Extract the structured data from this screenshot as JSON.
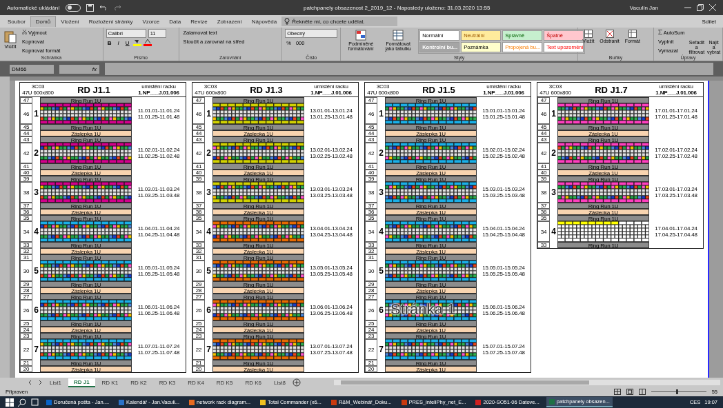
{
  "window": {
    "autosave_label": "Automatické ukládání",
    "autosave_on": false,
    "title": "patchpanely obsazenost 2_2019_12  -  Naposledy uloženo: 31.03.2020 13:55",
    "user": "Vaculín Jan"
  },
  "menu_tabs": [
    {
      "label": "Soubor",
      "selected": false
    },
    {
      "label": "Domů",
      "selected": true
    },
    {
      "label": "Vložení",
      "selected": false
    },
    {
      "label": "Rozložení stránky",
      "selected": false
    },
    {
      "label": "Vzorce",
      "selected": false
    },
    {
      "label": "Data",
      "selected": false
    },
    {
      "label": "Revize",
      "selected": false
    },
    {
      "label": "Zobrazení",
      "selected": false
    },
    {
      "label": "Nápověda",
      "selected": false
    }
  ],
  "tell_me": {
    "placeholder": "Řekněte mi, co chcete udělat."
  },
  "share_label": "Sdílet",
  "ribbon": {
    "clipboard": {
      "paste": "Vložit",
      "cut": "Vyjmout",
      "copy": "Kopírovat",
      "format_painter": "Kopírovat formát",
      "group": "Schránka"
    },
    "font": {
      "name": "Calibri",
      "size": "11",
      "buttons": [
        "B",
        "I",
        "U"
      ],
      "group": "Písmo"
    },
    "alignment": {
      "wrap": "Zalamovat text",
      "merge": "Sloučit a zarovnat na střed",
      "group": "Zarovnání"
    },
    "number": {
      "format": "Obecný",
      "percent": "%",
      "thousands": "000",
      "group": "Číslo"
    },
    "styles": {
      "conditional": "Podmíněné formátování",
      "as_table": "Formátovat jako tabulku",
      "group": "Styly",
      "cells": [
        {
          "label": "Normální",
          "color": "#ffffff"
        },
        {
          "label": "Neutrální",
          "color": "#ffeb9c"
        },
        {
          "label": "Správně",
          "color": "#c6efce"
        },
        {
          "label": "Špatně",
          "color": "#ffc7ce"
        },
        {
          "label": "Kontrolní bu...",
          "color": "#a5a5a5"
        },
        {
          "label": "Poznámka",
          "color": "#ffffcc"
        },
        {
          "label": "Propojená bu...",
          "color": "#ffffff"
        },
        {
          "label": "Text upozornění",
          "color": "#ffffff"
        }
      ]
    },
    "cells": {
      "insert": "Vložit",
      "delete": "Odstranit",
      "format": "Formát",
      "group": "Buňky"
    },
    "editing": {
      "autosum": "AutoSum",
      "fill": "Vyplnit",
      "clear": "Vymazat",
      "sort": "Seřadit a filtrovat",
      "find": "Najít a vybrat",
      "group": "Úpravy"
    }
  },
  "formula_bar": {
    "name_box": "DM66",
    "fx": "fx"
  },
  "page_label": "Stránka 1",
  "racks": [
    {
      "title": "RD J1.1",
      "code": "3C03",
      "size": "47U  600x800",
      "location_label": "umístění racku",
      "location": "1.NP___J.01.006",
      "units": [
        {
          "kind": "ringrun",
          "u": "47",
          "label": "Ring Run 1U"
        },
        {
          "kind": "panel",
          "u": "46",
          "number": "1",
          "color": "#d4008c",
          "filled": true,
          "ranges": [
            "11.01.01-11.01.24",
            "11.01.25-11.01.48"
          ]
        },
        {
          "kind": "ringrun",
          "u": "45",
          "label": "Ring Run 1U"
        },
        {
          "kind": "blank",
          "u": "44",
          "label": "Záslepka 1U"
        },
        {
          "kind": "ringrun",
          "u": "43",
          "label": "Ring Run 1U"
        },
        {
          "kind": "panel",
          "u": "42",
          "number": "2",
          "color": "#d4008c",
          "filled": true,
          "ranges": [
            "11.02.01-11.02.24",
            "11.02.25-11.02.48"
          ]
        },
        {
          "kind": "ringrun",
          "u": "41",
          "label": "Ring Run 1U"
        },
        {
          "kind": "blank",
          "u": "40",
          "label": "Záslepka 1U"
        },
        {
          "kind": "ringrun",
          "u": "39",
          "label": "Ring Run 1U"
        },
        {
          "kind": "panel",
          "u": "38",
          "number": "3",
          "color": "#d4008c",
          "filled": true,
          "ranges": [
            "11.03.01-11.03.24",
            "11.03.25-11.03.48"
          ]
        },
        {
          "kind": "ringrun",
          "u": "37",
          "label": "Ring Run 1U"
        },
        {
          "kind": "blank",
          "u": "36",
          "label": "Záslepka 1U"
        },
        {
          "kind": "ringrun",
          "u": "35",
          "label": "Ring Run 1U"
        },
        {
          "kind": "panel",
          "u": "34",
          "number": "4",
          "color": "#1ab0e8",
          "filled": true,
          "ranges": [
            "11.04.01-11.04.24",
            "11.04.25-11.04.48"
          ]
        },
        {
          "kind": "ringrun",
          "u": "33",
          "label": "Ring Run 1U"
        },
        {
          "kind": "blank",
          "u": "32",
          "label": "Záslepka 1U"
        },
        {
          "kind": "ringrun",
          "u": "31",
          "label": "Ring Run 1U"
        },
        {
          "kind": "panel",
          "u": "30",
          "number": "5",
          "color": "#1ab0e8",
          "filled": true,
          "ranges": [
            "11.05.01-11.05.24",
            "11.05.25-11.05.48"
          ]
        },
        {
          "kind": "ringrun",
          "u": "29",
          "label": "Ring Run 1U"
        },
        {
          "kind": "blank",
          "u": "28",
          "label": "Záslepka 1U"
        },
        {
          "kind": "ringrun",
          "u": "27",
          "label": "Ring Run 1U"
        },
        {
          "kind": "panel",
          "u": "26",
          "number": "6",
          "color": "#1ab0e8",
          "filled": true,
          "ranges": [
            "11.06.01-11.06.24",
            "11.06.25-11.06.48"
          ]
        },
        {
          "kind": "ringrun",
          "u": "25",
          "label": "Ring Run 1U"
        },
        {
          "kind": "blank",
          "u": "24",
          "label": "Záslepka 1U"
        },
        {
          "kind": "ringrun",
          "u": "23",
          "label": "Ring Run 1U"
        },
        {
          "kind": "panel",
          "u": "22",
          "number": "7",
          "color": "#1ab0e8",
          "filled": true,
          "ranges": [
            "11.07.01-11.07.24",
            "11.07.25-11.07.48"
          ]
        },
        {
          "kind": "ringrun",
          "u": "21",
          "label": "Ring Run 1U"
        },
        {
          "kind": "blank",
          "u": "20",
          "label": "Záslepka 1U"
        }
      ]
    },
    {
      "title": "RD J1.3",
      "code": "3C03",
      "size": "47U  600x800",
      "location_label": "umístění racku",
      "location": "1.NP___J.01.006",
      "units": [
        {
          "kind": "ringrun",
          "u": "47",
          "label": "Ring Run 1U"
        },
        {
          "kind": "panel",
          "u": "46",
          "number": "1",
          "color": "#d2d200",
          "filled": true,
          "ranges": [
            "13.01.01-13.01.24",
            "13.01.25-13.01.48"
          ]
        },
        {
          "kind": "ringrun",
          "u": "45",
          "label": "Ring Run 1U"
        },
        {
          "kind": "blank",
          "u": "44",
          "label": "Záslepka 1U"
        },
        {
          "kind": "ringrun",
          "u": "43",
          "label": "Ring Run 1U"
        },
        {
          "kind": "panel",
          "u": "42",
          "number": "2",
          "color": "#d2d200",
          "filled": true,
          "ranges": [
            "13.02.01-13.02.24",
            "13.02.25-13.02.48"
          ]
        },
        {
          "kind": "ringrun",
          "u": "41",
          "label": "Ring Run 1U"
        },
        {
          "kind": "blank",
          "u": "40",
          "label": "Záslepka 1U"
        },
        {
          "kind": "ringrun",
          "u": "39",
          "label": "Ring Run 1U"
        },
        {
          "kind": "panel",
          "u": "38",
          "number": "3",
          "color": "#d2d200",
          "filled": true,
          "ranges": [
            "13.03.01-13.03.24",
            "13.03.25-13.03.48"
          ]
        },
        {
          "kind": "ringrun",
          "u": "37",
          "label": "Ring Run 1U"
        },
        {
          "kind": "blank",
          "u": "36",
          "label": "Záslepka 1U"
        },
        {
          "kind": "ringrun",
          "u": "35",
          "label": "Ring Run 1U"
        },
        {
          "kind": "panel",
          "u": "34",
          "number": "4",
          "color": "#e86a00",
          "filled": true,
          "ranges": [
            "13.04.01-13.04.24",
            "13.04.25-13.04.48"
          ]
        },
        {
          "kind": "ringrun",
          "u": "33",
          "label": "Ring Run 1U"
        },
        {
          "kind": "blank",
          "u": "32",
          "label": "Záslepka 1U"
        },
        {
          "kind": "ringrun",
          "u": "31",
          "label": "Ring Run 1U"
        },
        {
          "kind": "panel",
          "u": "30",
          "number": "5",
          "color": "#e86a00",
          "filled": true,
          "ranges": [
            "13.05.01-13.05.24",
            "13.05.25-13.05.48"
          ]
        },
        {
          "kind": "ringrun",
          "u": "29",
          "label": "Ring Run 1U"
        },
        {
          "kind": "blank",
          "u": "28",
          "label": "Záslepka 1U"
        },
        {
          "kind": "ringrun",
          "u": "27",
          "label": "Ring Run 1U"
        },
        {
          "kind": "panel",
          "u": "26",
          "number": "6",
          "color": "#e86a00",
          "filled": true,
          "ranges": [
            "13.06.01-13.06.24",
            "13.06.25-13.06.48"
          ]
        },
        {
          "kind": "ringrun",
          "u": "25",
          "label": "Ring Run 1U"
        },
        {
          "kind": "blank",
          "u": "24",
          "label": "Záslepka 1U"
        },
        {
          "kind": "ringrun",
          "u": "23",
          "label": "Ring Run 1U"
        },
        {
          "kind": "panel",
          "u": "22",
          "number": "7",
          "color": "#e86a00",
          "filled": true,
          "ranges": [
            "13.07.01-13.07.24",
            "13.07.25-13.07.48"
          ]
        },
        {
          "kind": "ringrun",
          "u": "21",
          "label": "Ring Run 1U"
        },
        {
          "kind": "blank",
          "u": "20",
          "label": "Záslepka 1U"
        }
      ]
    },
    {
      "title": "RD J1.5",
      "code": "3C03",
      "size": "47U  600x800",
      "location_label": "umístění racku",
      "location": "1.NP___J.01.006",
      "units": [
        {
          "kind": "ringrun",
          "u": "47",
          "label": "Ring Run 1U"
        },
        {
          "kind": "panel",
          "u": "46",
          "number": "1",
          "color": "#1ab0e8",
          "filled": true,
          "ranges": [
            "15.01.01-15.01.24",
            "15.01.25-15.01.48"
          ]
        },
        {
          "kind": "ringrun",
          "u": "45",
          "label": "Ring Run 1U"
        },
        {
          "kind": "blank",
          "u": "44",
          "label": "Záslepka 1U"
        },
        {
          "kind": "ringrun",
          "u": "43",
          "label": "Ring Run 1U"
        },
        {
          "kind": "panel",
          "u": "42",
          "number": "2",
          "color": "#1ab0e8",
          "filled": true,
          "ranges": [
            "15.02.01-15.02.24",
            "15.02.25-15.02.48"
          ]
        },
        {
          "kind": "ringrun",
          "u": "41",
          "label": "Ring Run 1U"
        },
        {
          "kind": "blank",
          "u": "40",
          "label": "Záslepka 1U"
        },
        {
          "kind": "ringrun",
          "u": "39",
          "label": "Ring Run 1U"
        },
        {
          "kind": "panel",
          "u": "38",
          "number": "3",
          "color": "#1ab0e8",
          "filled": true,
          "ranges": [
            "15.03.01-15.03.24",
            "15.03.25-15.03.48"
          ]
        },
        {
          "kind": "ringrun",
          "u": "37",
          "label": "Ring Run 1U"
        },
        {
          "kind": "blank",
          "u": "36",
          "label": "Záslepka 1U"
        },
        {
          "kind": "ringrun",
          "u": "35",
          "label": "Ring Run 1U"
        },
        {
          "kind": "panel",
          "u": "34",
          "number": "4",
          "color": "#1ab0e8",
          "filled": true,
          "ranges": [
            "15.04.01-15.04.24",
            "15.04.25-15.04.48"
          ]
        },
        {
          "kind": "ringrun",
          "u": "33",
          "label": "Ring Run 1U"
        },
        {
          "kind": "blank",
          "u": "32",
          "label": "Záslepka 1U"
        },
        {
          "kind": "ringrun",
          "u": "31",
          "label": "Ring Run 1U"
        },
        {
          "kind": "panel",
          "u": "30",
          "number": "5",
          "color": "#1ab0e8",
          "filled": true,
          "ranges": [
            "15.05.01-15.05.24",
            "15.05.25-15.05.48"
          ]
        },
        {
          "kind": "ringrun",
          "u": "29",
          "label": "Ring Run 1U"
        },
        {
          "kind": "blank",
          "u": "28",
          "label": "Záslepka 1U"
        },
        {
          "kind": "ringrun",
          "u": "27",
          "label": "Ring Run 1U"
        },
        {
          "kind": "panel",
          "u": "26",
          "number": "6",
          "color": "#1ab0e8",
          "filled": true,
          "ranges": [
            "15.06.01-15.06.24",
            "15.06.25-15.06.48"
          ]
        },
        {
          "kind": "ringrun",
          "u": "25",
          "label": "Ring Run 1U"
        },
        {
          "kind": "blank",
          "u": "24",
          "label": "Záslepka 1U"
        },
        {
          "kind": "ringrun",
          "u": "23",
          "label": "Ring Run 1U"
        },
        {
          "kind": "panel",
          "u": "22",
          "number": "7",
          "color": "#1ab0e8",
          "filled": true,
          "ranges": [
            "15.07.01-15.07.24",
            "15.07.25-15.07.48"
          ]
        },
        {
          "kind": "ringrun",
          "u": "21",
          "label": "Ring Run 1U"
        },
        {
          "kind": "blank",
          "u": "20",
          "label": "Záslepka 1U"
        }
      ]
    },
    {
      "title": "RD J1.7",
      "code": "3C03",
      "size": "47U  600x800",
      "location_label": "umístění racku",
      "location": "1.NP___J.01.006",
      "units": [
        {
          "kind": "ringrun",
          "u": "47",
          "label": "Ring Run 1U"
        },
        {
          "kind": "panel",
          "u": "46",
          "number": "1",
          "color": "#ff3fbf",
          "filled": true,
          "ranges": [
            "17.01.01-17.01.24",
            "17.01.25-17.01.48"
          ]
        },
        {
          "kind": "ringrun",
          "u": "45",
          "label": "Ring Run 1U"
        },
        {
          "kind": "blank",
          "u": "44",
          "label": "Záslepka 1U"
        },
        {
          "kind": "ringrun",
          "u": "43",
          "label": "Ring Run 1U"
        },
        {
          "kind": "panel",
          "u": "42",
          "number": "2",
          "color": "#ff3fbf",
          "filled": true,
          "ranges": [
            "17.02.01-17.02.24",
            "17.02.25-17.02.48"
          ]
        },
        {
          "kind": "ringrun",
          "u": "41",
          "label": "Ring Run 1U"
        },
        {
          "kind": "blank",
          "u": "40",
          "label": "Záslepka 1U"
        },
        {
          "kind": "ringrun",
          "u": "39",
          "label": "Ring Run 1U"
        },
        {
          "kind": "panel",
          "u": "38",
          "number": "3",
          "color": "#ff3fbf",
          "filled": true,
          "ranges": [
            "17.03.01-17.03.24",
            "17.03.25-17.03.48"
          ]
        },
        {
          "kind": "ringrun",
          "u": "37",
          "label": "Ring Run 1U"
        },
        {
          "kind": "blank",
          "u": "36",
          "label": "Záslepka 1U"
        },
        {
          "kind": "ringrun",
          "u": "35",
          "label": "Ring Run 1U"
        },
        {
          "kind": "panel",
          "u": "34",
          "number": "4",
          "color": "#ffff00",
          "filled": false,
          "ranges": [
            "17.04.01-17.04.24",
            "17.04.25-17.04.48"
          ]
        },
        {
          "kind": "ringrun",
          "u": "33",
          "label": "Ring Run 1U"
        }
      ]
    }
  ],
  "sheet_tabs": [
    {
      "label": "List1",
      "selected": false
    },
    {
      "label": "RD J1",
      "selected": true
    },
    {
      "label": "RD K1",
      "selected": false
    },
    {
      "label": "RD K2",
      "selected": false
    },
    {
      "label": "RD K3",
      "selected": false
    },
    {
      "label": "RD K4",
      "selected": false
    },
    {
      "label": "RD K5",
      "selected": false
    },
    {
      "label": "RD K6",
      "selected": false
    },
    {
      "label": "List8",
      "selected": false
    }
  ],
  "status": {
    "text": "Připraven",
    "zoom": "55",
    "zoom_slider": {
      "level": 0.45
    }
  },
  "taskbar": {
    "items": [
      {
        "label": "Doručená pošta - Jan....",
        "active": false
      },
      {
        "label": "Kalendář - Jan.Vaculi...",
        "active": false
      },
      {
        "label": "network rack diagram...",
        "active": false
      },
      {
        "label": "Total Commander (x6...",
        "active": false
      },
      {
        "label": "R&M_Webinář_Doku...",
        "active": false
      },
      {
        "label": "PRES_inteliPhy_net_E...",
        "active": false
      },
      {
        "label": "2020-SO51-06 Datove...",
        "active": false
      },
      {
        "label": "patchpanely obsazen...",
        "active": true
      }
    ],
    "language": "CES",
    "time": "19:07"
  }
}
